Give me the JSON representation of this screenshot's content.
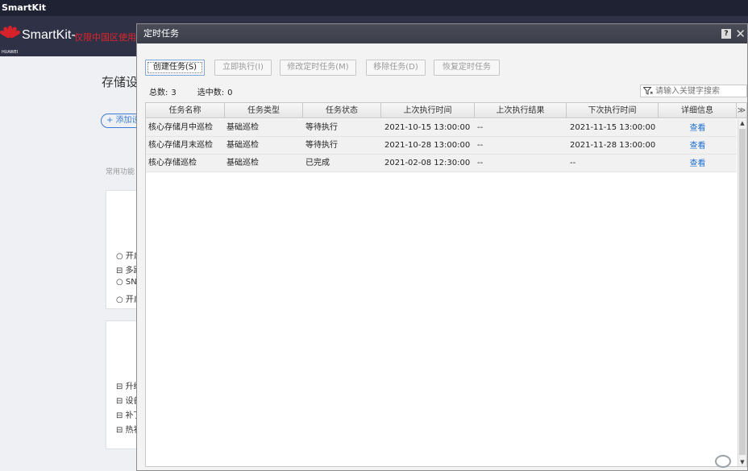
{
  "os": {
    "title": "SmartKit"
  },
  "app": {
    "logo_text": "HUAWEI",
    "name": "SmartKit-",
    "subtitle": "仅限中国区使用"
  },
  "background": {
    "heading": "存储设",
    "add_button": "+ 添加设",
    "section_label": "常用功能",
    "card1_items": [
      "○ 开启",
      "⊟ 多路",
      "○ SN",
      "○ 开启"
    ],
    "card2_items": [
      "⊟ 升级",
      "⊟ 设备",
      "⊟ 补丁",
      "⊟ 热补"
    ]
  },
  "dialog": {
    "title": "定时任务",
    "help_label": "?",
    "close_label": "✕",
    "toolbar": {
      "create": "创建任务(S)",
      "run_now": "立即执行(I)",
      "modify": "修改定时任务(M)",
      "remove": "移除任务(D)",
      "restore": "恢复定时任务"
    },
    "stats": {
      "total_label": "总数:",
      "total_value": "3",
      "selected_label": "选中数:",
      "selected_value": "0"
    },
    "search": {
      "placeholder": "请输入关键字搜索"
    },
    "table": {
      "headers": [
        "任务名称",
        "任务类型",
        "任务状态",
        "上次执行时间",
        "上次执行结果",
        "下次执行时间",
        "详细信息"
      ],
      "more_label": "≫",
      "rows": [
        {
          "name": "核心存储月中巡检",
          "type": "基础巡检",
          "status": "等待执行",
          "last_time": "2021-10-15 13:00:00",
          "last_result": "--",
          "next_time": "2021-11-15 13:00:00",
          "detail": "查看"
        },
        {
          "name": "核心存储月末巡检",
          "type": "基础巡检",
          "status": "等待执行",
          "last_time": "2021-10-28 13:00:00",
          "last_result": "--",
          "next_time": "2021-11-28 13:00:00",
          "detail": "查看"
        },
        {
          "name": "核心存储巡检",
          "type": "基础巡检",
          "status": "已完成",
          "last_time": "2021-02-08 12:30:00",
          "last_result": "--",
          "next_time": "--",
          "detail": "查看"
        }
      ]
    }
  },
  "colors": {
    "header_bg": "#2f3247",
    "brand_red": "#d8222a",
    "link_blue": "#1f6fd1",
    "accent_blue": "#3a7bd5"
  }
}
